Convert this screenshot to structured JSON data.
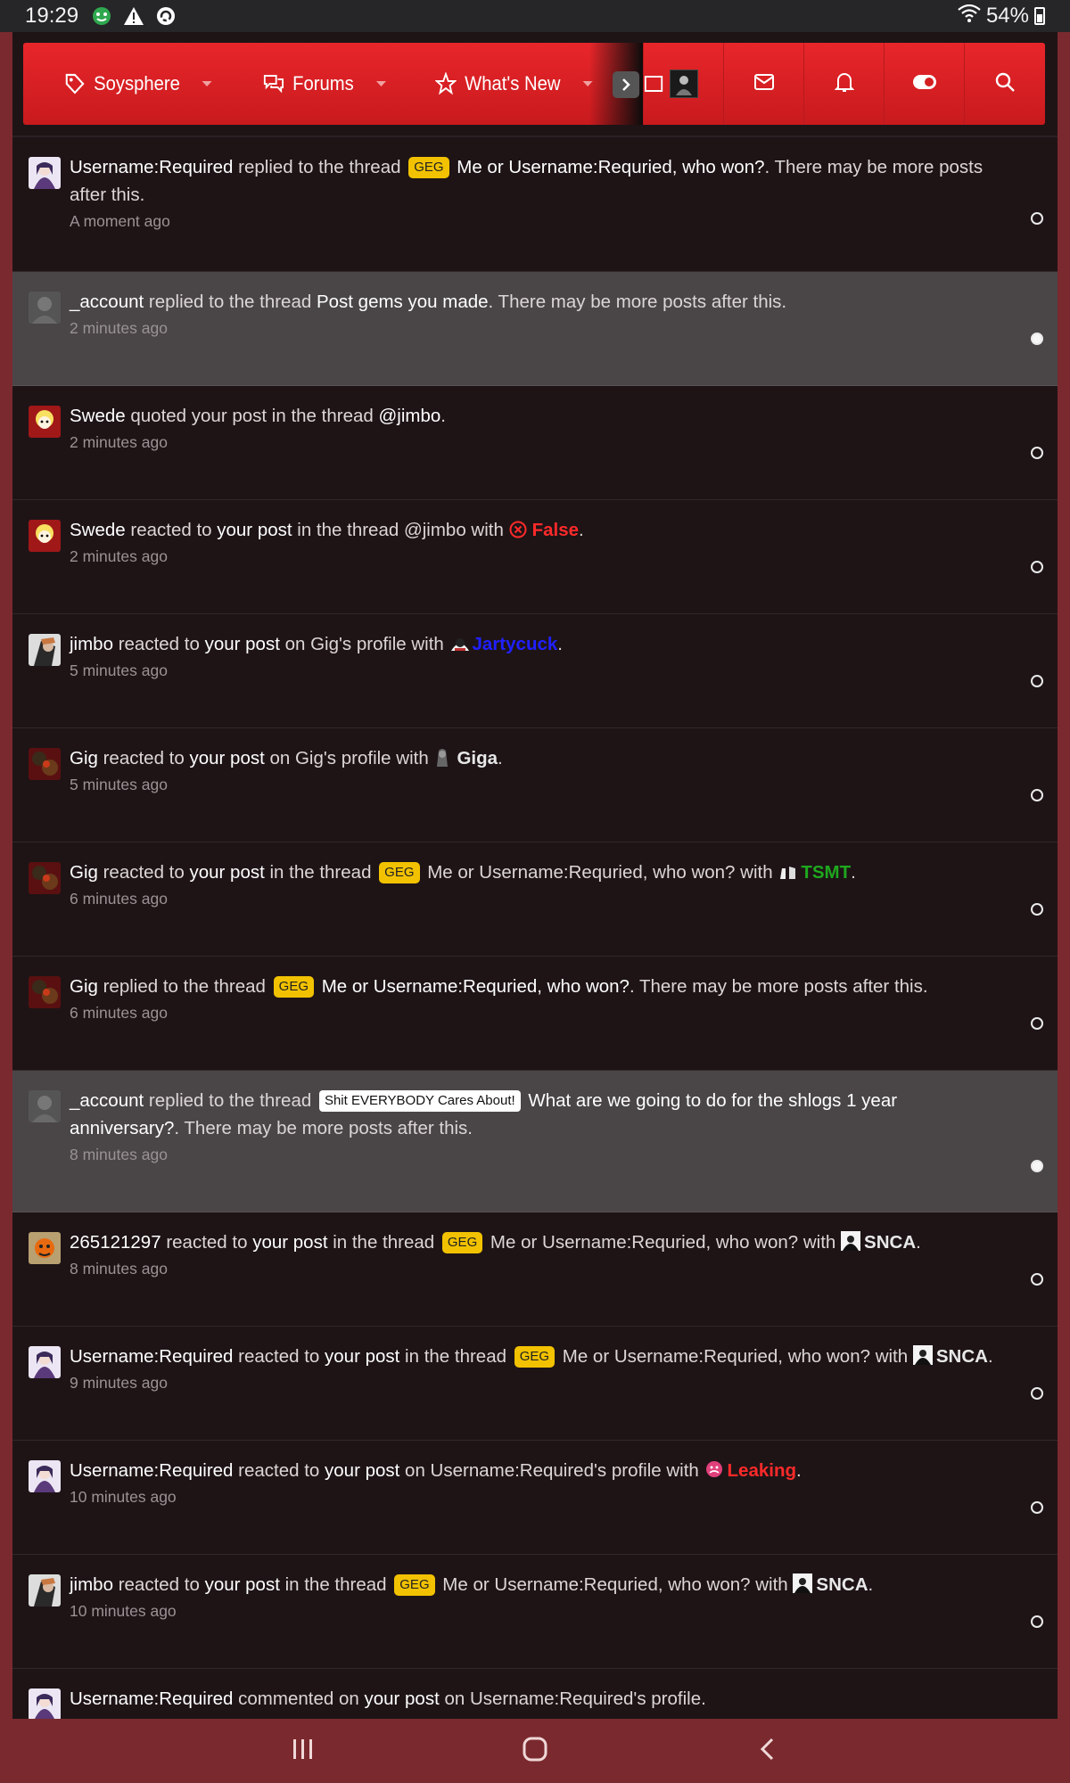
{
  "status": {
    "time": "19:29",
    "battery": "54%"
  },
  "nav": {
    "tabs": [
      {
        "label": "Soysphere",
        "icon": "tag-icon"
      },
      {
        "label": "Forums",
        "icon": "chat-bubbles-icon"
      },
      {
        "label": "What's New",
        "icon": "star-icon"
      }
    ],
    "icons": [
      "avatar",
      "mail-icon",
      "bell-icon",
      "toggle-icon",
      "search-icon"
    ]
  },
  "notifications": [
    {
      "user": "Username:Required",
      "action": " replied to the thread ",
      "badge": "GEG",
      "thread": "Me or Username:Requried, who won?",
      "tail": ". There may be more posts after this.",
      "time": "A moment ago",
      "unread": false
    },
    {
      "user": "_account",
      "action": " replied to the thread ",
      "thread": "Post gems you made",
      "tail": ". There may be more posts after this.",
      "time": "2 minutes ago",
      "unread": true
    },
    {
      "user": "Swede",
      "action": " quoted your post in the thread ",
      "thread": "@jimbo",
      "tail": ".",
      "time": "2 minutes ago",
      "unread": false
    },
    {
      "user": "Swede",
      "pre": " reacted to ",
      "yourpost": "your post",
      "mid": " in the thread @jimbo with ",
      "reaction": "False",
      "time": "2 minutes ago",
      "unread": false
    },
    {
      "user": "jimbo",
      "pre": " reacted to ",
      "yourpost": "your post",
      "mid": " on Gig's profile with ",
      "reaction": "Jartycuck",
      "time": "5 minutes ago",
      "unread": false
    },
    {
      "user": "Gig",
      "pre": " reacted to ",
      "yourpost": "your post",
      "mid": " on Gig's profile with ",
      "reaction": "Giga",
      "time": "5 minutes ago",
      "unread": false
    },
    {
      "user": "Gig",
      "pre": " reacted to ",
      "yourpost": "your post",
      "mid": " in the thread ",
      "badge": "GEG",
      "mid2": " Me or Username:Requried, who won? with ",
      "reaction": "TSMT",
      "time": "6 minutes ago",
      "unread": false
    },
    {
      "user": "Gig",
      "action": " replied to the thread ",
      "badge": "GEG",
      "thread": "Me or Username:Requried, who won?",
      "tail": ". There may be more posts after this.",
      "time": "6 minutes ago",
      "unread": false
    },
    {
      "user": "_account",
      "action": " replied to the thread ",
      "badge": "Shit EVERYBODY Cares About!",
      "thread": "What are we going to do for the shlogs 1 year anniversary?",
      "tail": ". There may be more posts after this.",
      "time": "8 minutes ago",
      "unread": true
    },
    {
      "user": "265121297",
      "pre": " reacted to ",
      "yourpost": "your post",
      "mid": " in the thread ",
      "badge": "GEG",
      "mid2": " Me or Username:Requried, who won? with ",
      "reaction": "SNCA",
      "time": "8 minutes ago",
      "unread": false
    },
    {
      "user": "Username:Required",
      "pre": " reacted to ",
      "yourpost": "your post",
      "mid": " in the thread ",
      "badge": "GEG",
      "mid2": " Me or Username:Requried, who won? with ",
      "reaction": "SNCA",
      "time": "9 minutes ago",
      "unread": false
    },
    {
      "user": "Username:Required",
      "pre": " reacted to ",
      "yourpost": "your post",
      "mid": " on Username:Required's profile with ",
      "reaction": "Leaking",
      "time": "10 minutes ago",
      "unread": false
    },
    {
      "user": "jimbo",
      "pre": " reacted to ",
      "yourpost": "your post",
      "mid": " in the thread ",
      "badge": "GEG",
      "mid2": " Me or Username:Requried, who won? with ",
      "reaction": "SNCA",
      "time": "10 minutes ago",
      "unread": false
    },
    {
      "user": "Username:Required",
      "pre": " commented on ",
      "yourpost": "your post",
      "mid": " on Username:Required's profile.",
      "time": "",
      "unread": false
    }
  ],
  "colors": {
    "navbar": "#e0221f",
    "badge_geg": "#f2c200",
    "reaction_red": "#ff2a2a",
    "reaction_blue": "#2020ff",
    "reaction_green": "#1ea81e"
  }
}
